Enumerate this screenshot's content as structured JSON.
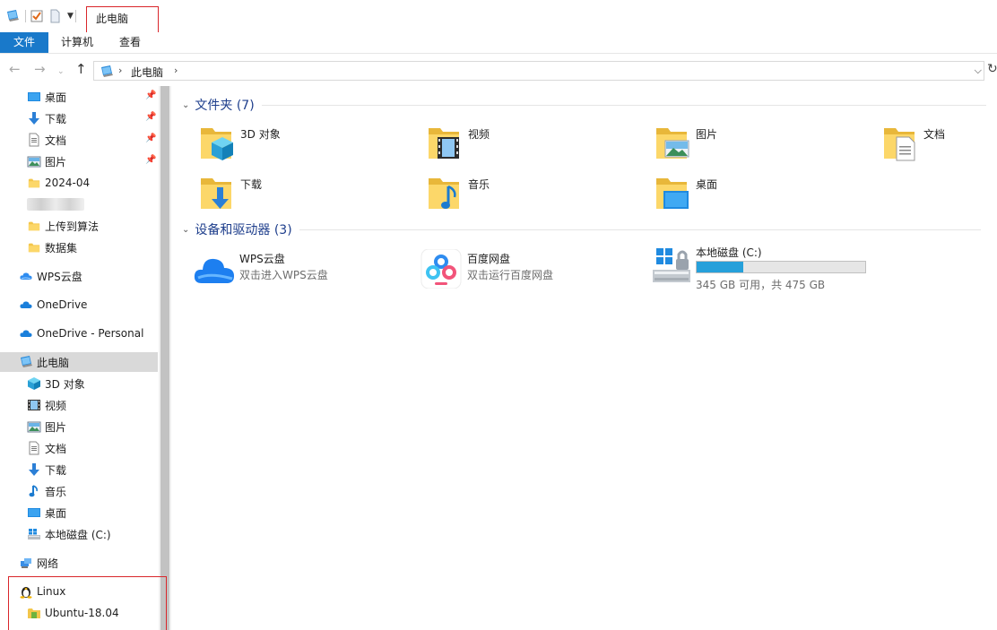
{
  "window": {
    "title": "此电脑"
  },
  "ribbon": {
    "tabs": [
      "文件",
      "计算机",
      "查看"
    ]
  },
  "address": {
    "crumb": "此电脑",
    "chevron": "›",
    "dropdown": "⌵",
    "refresh": "↻"
  },
  "nav_buttons": {
    "back": "←",
    "forward": "→",
    "history": "⌄",
    "up": "↑"
  },
  "navpane": {
    "quick_access": [
      {
        "label": "桌面",
        "pinned": true
      },
      {
        "label": "下载",
        "pinned": true
      },
      {
        "label": "文档",
        "pinned": true
      },
      {
        "label": "图片",
        "pinned": true
      },
      {
        "label": "2024-04",
        "pinned": false
      },
      {
        "label": "上传到算法",
        "pinned": false
      },
      {
        "label": "数据集",
        "pinned": false
      }
    ],
    "wps": "WPS云盘",
    "onedrive": "OneDrive",
    "onedrive_personal": "OneDrive - Personal",
    "this_pc": "此电脑",
    "pc_children": [
      "3D 对象",
      "视频",
      "图片",
      "文档",
      "下载",
      "音乐",
      "桌面",
      "本地磁盘 (C:)"
    ],
    "network": "网络",
    "linux": "Linux",
    "ubuntu": "Ubuntu-18.04"
  },
  "main": {
    "folders_header": "文件夹 (7)",
    "folders": [
      "3D 对象",
      "视频",
      "图片",
      "文档",
      "下载",
      "音乐",
      "桌面"
    ],
    "devices_header": "设备和驱动器 (3)",
    "devices": [
      {
        "name": "WPS云盘",
        "sub": "双击进入WPS云盘"
      },
      {
        "name": "百度网盘",
        "sub": "双击运行百度网盘"
      }
    ],
    "drive": {
      "name": "本地磁盘 (C:)",
      "free_gb": 345,
      "total_gb": 475,
      "used_fraction": 0.274,
      "caption": "345 GB 可用，共 475 GB"
    }
  },
  "colors": {
    "accent": "#1979ca",
    "highlight": "#d9262b",
    "drive_fill": "#26a0da",
    "group_title": "#1e3e8c"
  },
  "icons": {
    "pin": "📌",
    "chevron_down": "⌄"
  }
}
